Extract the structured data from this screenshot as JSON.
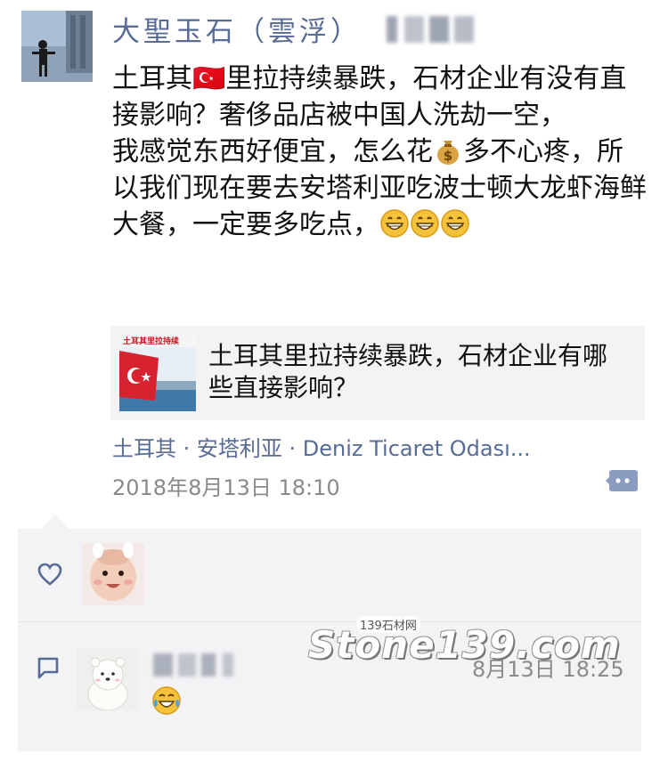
{
  "post": {
    "author": "大聖玉石（雲浮）",
    "paragraph1": "土耳其🇹🇷里拉持续暴跌，石材企业有没有直接影响？奢侈品店被中国人洗劫一空，",
    "paragraph2_part1": "我感觉东西好便宜，怎么花",
    "paragraph2_part2": "多不心疼，所以我们现在要去安塔利亚吃波士顿大龙虾海鲜大餐，一定要多吃点，",
    "shared_link_title": "土耳其里拉持续暴跌，石材企业有哪些直接影响？",
    "shared_link_thumb_text": "土耳其里拉持续",
    "location": "土耳其 · 安塔利亚 · Deniz Ticaret Odası...",
    "timestamp": "2018年8月13日 18:10"
  },
  "interactions": {
    "comment_time": "8月13日 18:25"
  },
  "watermark": {
    "main": "Stone139.com",
    "small": "139石材网"
  },
  "icons": {
    "more": "more-dots-icon",
    "like": "heart-icon",
    "comment": "comment-icon",
    "money": "money-bag-emoji",
    "grin": "grinning-emoji",
    "laugh": "tears-of-joy-emoji",
    "flag": "turkey-flag-emoji"
  },
  "colors": {
    "link_blue": "#576b95",
    "meta_grey": "#8a8a8a",
    "panel_bg": "#f3f3f5"
  }
}
